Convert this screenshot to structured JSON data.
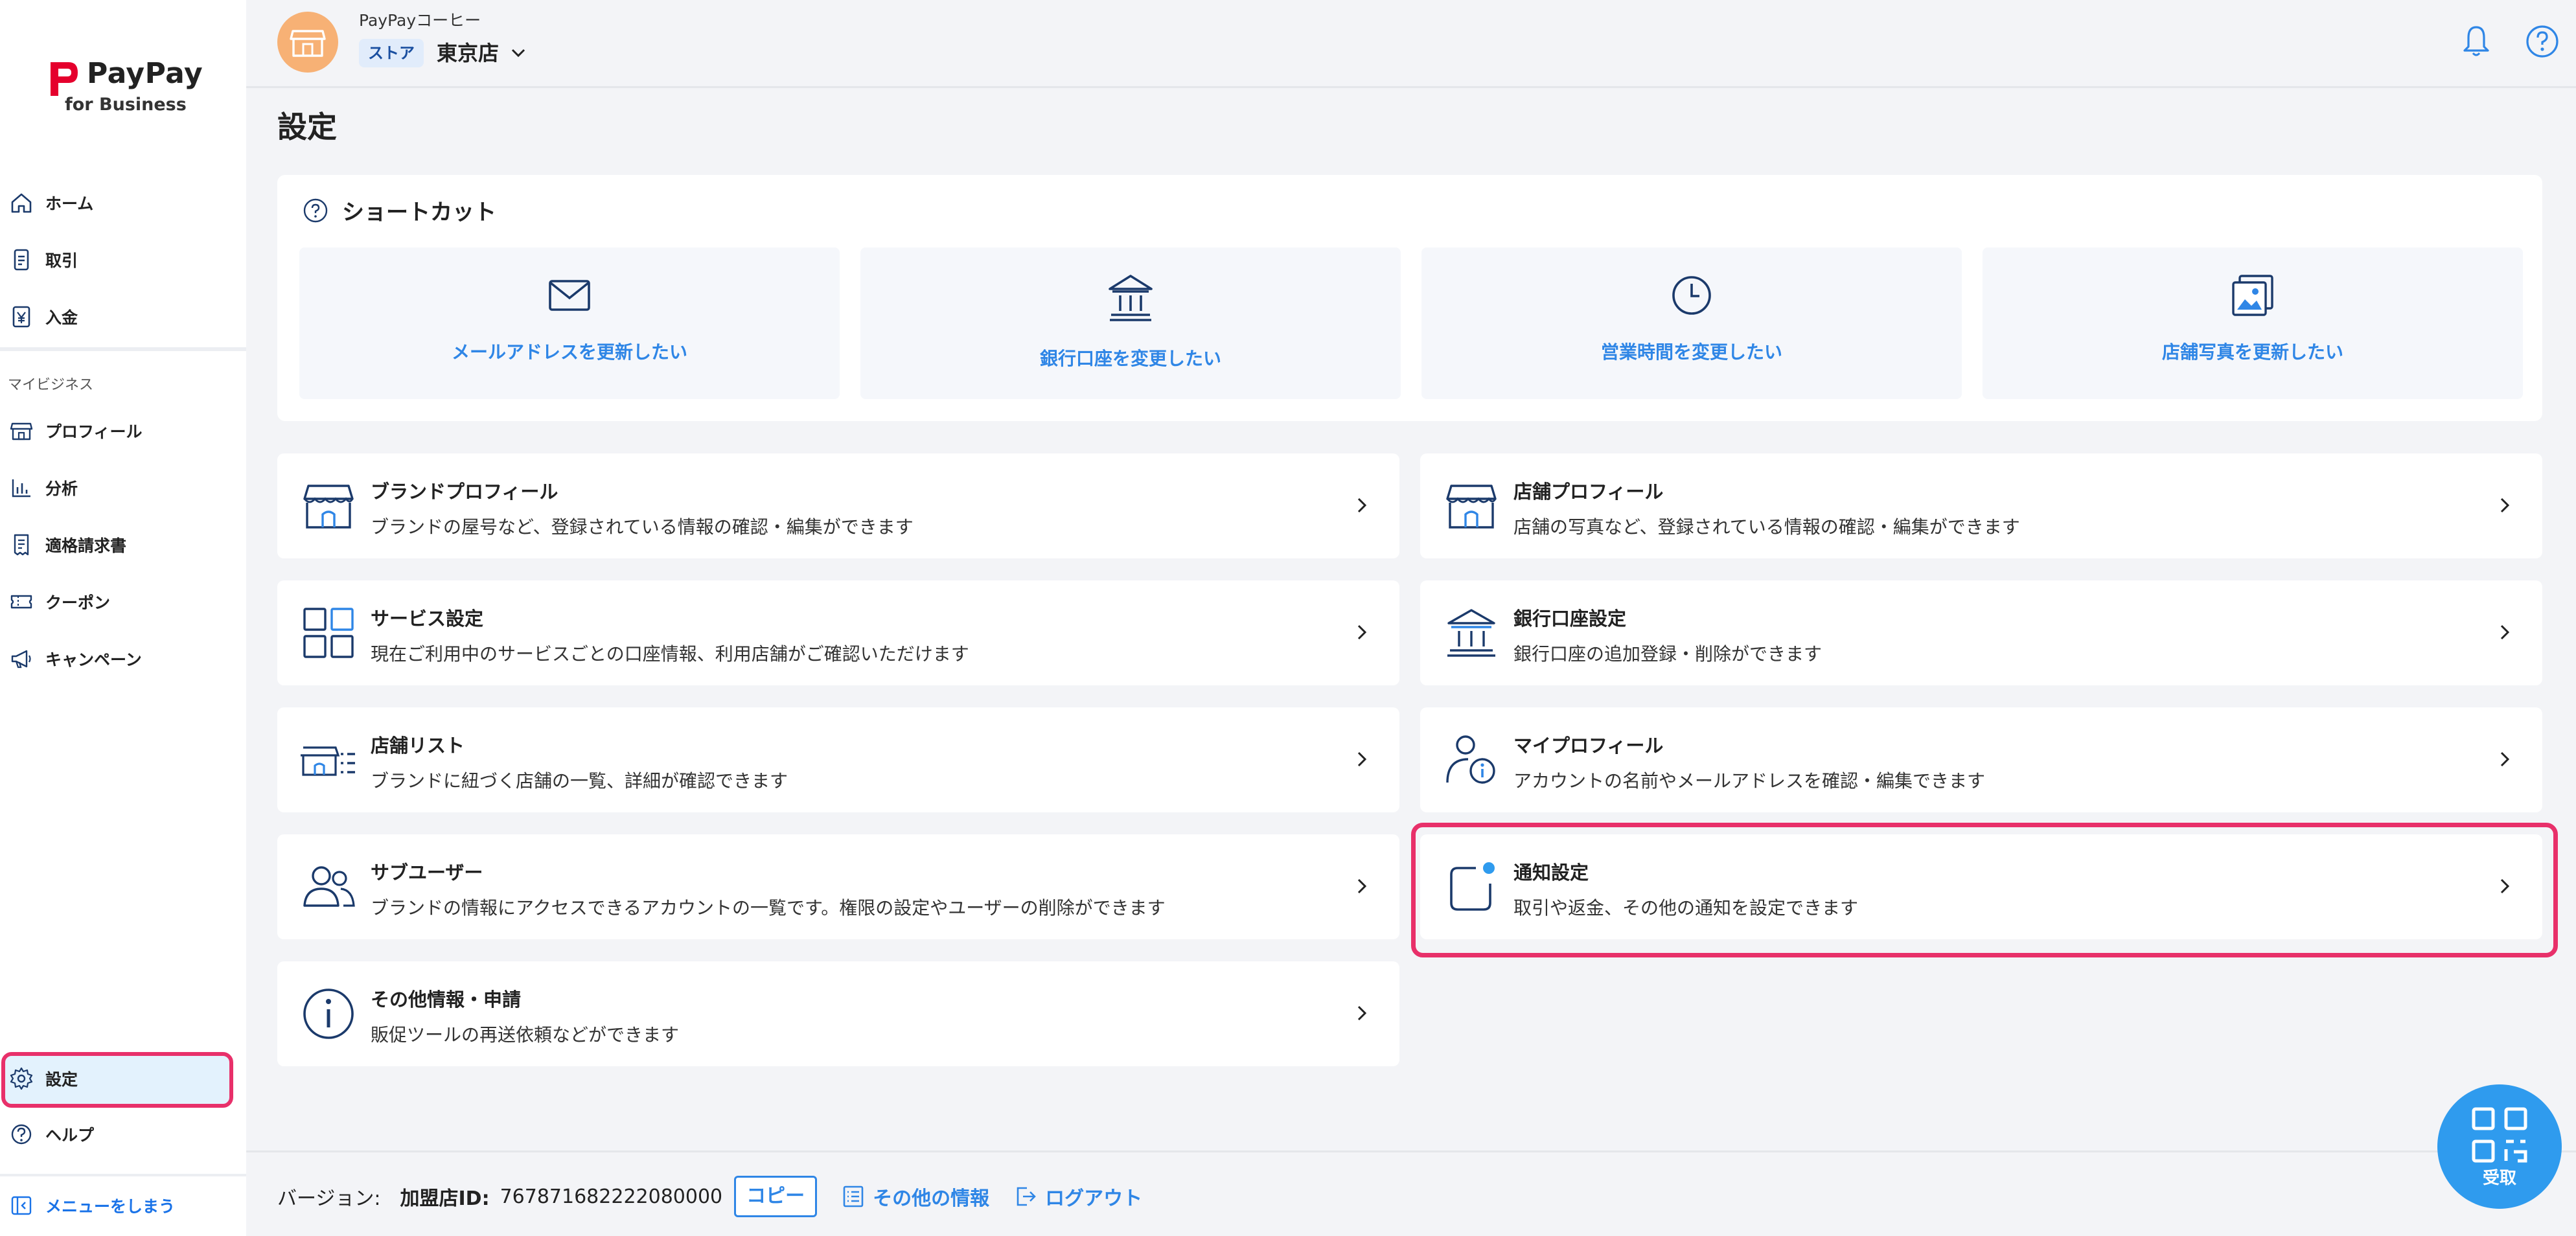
{
  "brand": {
    "name": "PayPay",
    "sub": "for Business",
    "color": "#e5002d"
  },
  "sidebar": {
    "items_top": [
      {
        "label": "ホーム",
        "icon": "home-icon"
      },
      {
        "label": "取引",
        "icon": "transaction-icon"
      },
      {
        "label": "入金",
        "icon": "deposit-icon"
      }
    ],
    "section_label": "マイビジネス",
    "items_business": [
      {
        "label": "プロフィール",
        "icon": "store-icon"
      },
      {
        "label": "分析",
        "icon": "chart-icon"
      },
      {
        "label": "適格請求書",
        "icon": "invoice-icon"
      },
      {
        "label": "クーポン",
        "icon": "coupon-icon"
      },
      {
        "label": "キャンペーン",
        "icon": "megaphone-icon"
      }
    ],
    "settings_label": "設定",
    "help_label": "ヘルプ",
    "collapse_label": "メニューをしまう"
  },
  "header": {
    "company": "PayPayコーヒー",
    "store_badge": "ストア",
    "store_name": "東京店"
  },
  "page": {
    "title": "設定"
  },
  "shortcuts": {
    "title": "ショートカット",
    "items": [
      {
        "label": "メールアドレスを更新したい",
        "icon": "mail-icon"
      },
      {
        "label": "銀行口座を変更したい",
        "icon": "bank-icon"
      },
      {
        "label": "営業時間を変更したい",
        "icon": "clock-icon"
      },
      {
        "label": "店舗写真を更新したい",
        "icon": "photo-icon"
      }
    ]
  },
  "settings": {
    "left": [
      {
        "title": "ブランドプロフィール",
        "desc": "ブランドの屋号など、登録されている情報の確認・編集ができます",
        "icon": "storefront-icon"
      },
      {
        "title": "サービス設定",
        "desc": "現在ご利用中のサービスごとの口座情報、利用店舗がご確認いただけます",
        "icon": "grid-icon"
      },
      {
        "title": "店舗リスト",
        "desc": "ブランドに紐づく店舗の一覧、詳細が確認できます",
        "icon": "store-list-icon"
      },
      {
        "title": "サブユーザー",
        "desc": "ブランドの情報にアクセスできるアカウントの一覧です。権限の設定やユーザーの削除ができます",
        "icon": "users-icon"
      },
      {
        "title": "その他情報・申請",
        "desc": "販促ツールの再送依頼などができます",
        "icon": "info-icon"
      }
    ],
    "right": [
      {
        "title": "店舗プロフィール",
        "desc": "店舗の写真など、登録されている情報の確認・編集ができます",
        "icon": "storefront-icon"
      },
      {
        "title": "銀行口座設定",
        "desc": "銀行口座の追加登録・削除ができます",
        "icon": "bank-icon"
      },
      {
        "title": "マイプロフィール",
        "desc": "アカウントの名前やメールアドレスを確認・編集できます",
        "icon": "user-info-icon"
      },
      {
        "title": "通知設定",
        "desc": "取引や返金、その他の通知を設定できます",
        "icon": "notification-icon"
      }
    ]
  },
  "footer": {
    "version_label": "バージョン:",
    "merchant_label": "加盟店ID:",
    "merchant_id": "767871682222080000",
    "copy_label": "コピー",
    "other_info_label": "その他の情報",
    "logout_label": "ログアウト"
  },
  "receive_button": {
    "label": "受取"
  },
  "colors": {
    "accent": "#2f86e6",
    "highlight": "#e8306a",
    "icon_navy": "#1b3a6b"
  }
}
